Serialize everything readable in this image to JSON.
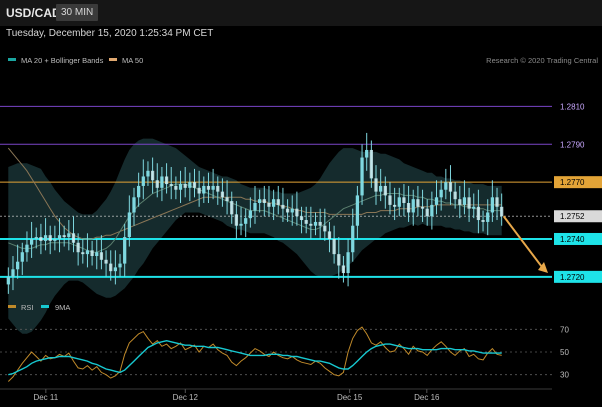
{
  "header": {
    "symbol": "USD/CAD",
    "timeframe": "30 MIN",
    "timestamp": "Tuesday, December 15, 2020 1:25:34 PM CET"
  },
  "legend_top": [
    {
      "label": "MA 20 + Bollinger Bands",
      "color": "#1aa6a0"
    },
    {
      "label": "MA 50",
      "color": "#e0a870"
    }
  ],
  "copyright": "Research © 2020 Trading Central",
  "legend_bottom": [
    {
      "label": "RSI",
      "color": "#c08a2a"
    },
    {
      "label": "9MA",
      "color": "#17c8d0"
    }
  ],
  "colors": {
    "background": "#000000",
    "candle": "#7fd8e0",
    "support": "#1ee3e8",
    "resistance_orange": "#e3a437",
    "resistance_purple": "#7a45c8",
    "arrow": "#e8a84a",
    "band_fill": "#1c3a3c"
  },
  "chart_data": [
    {
      "type": "candlestick",
      "title": "USD/CAD",
      "ylim": [
        1.2712,
        1.2825
      ],
      "y_ticks": [
        1.272,
        1.274,
        1.2752,
        1.277,
        1.279,
        1.281
      ],
      "x_tick_labels": [
        "Dec 11",
        "Dec 12",
        "Dec 15",
        "Dec 16"
      ],
      "current_price": 1.2752,
      "levels": [
        {
          "value": 1.281,
          "label": "1.2810",
          "kind": "resistance",
          "color": "#7a45c8"
        },
        {
          "value": 1.279,
          "label": "1.2790",
          "kind": "resistance",
          "color": "#7a45c8"
        },
        {
          "value": 1.277,
          "label": "1.2770",
          "kind": "pivot",
          "color": "#e3a437"
        },
        {
          "value": 1.2752,
          "label": "1.2752",
          "kind": "last-price",
          "color": "#cfcfcf"
        },
        {
          "value": 1.274,
          "label": "1.2740",
          "kind": "support",
          "color": "#1ee3e8"
        },
        {
          "value": 1.272,
          "label": "1.2720",
          "kind": "support",
          "color": "#1ee3e8"
        }
      ],
      "close": [
        1.272,
        1.2724,
        1.2728,
        1.2733,
        1.2737,
        1.274,
        1.2741,
        1.2739,
        1.2742,
        1.2739,
        1.274,
        1.2742,
        1.2741,
        1.2743,
        1.2738,
        1.2733,
        1.2732,
        1.2734,
        1.2731,
        1.2733,
        1.2729,
        1.2727,
        1.2723,
        1.2725,
        1.2727,
        1.2741,
        1.2754,
        1.2762,
        1.2768,
        1.2773,
        1.2776,
        1.2771,
        1.2767,
        1.2773,
        1.2769,
        1.2768,
        1.2766,
        1.2769,
        1.2767,
        1.277,
        1.2767,
        1.2764,
        1.2768,
        1.2766,
        1.2768,
        1.2765,
        1.2762,
        1.276,
        1.2753,
        1.2747,
        1.2748,
        1.2751,
        1.2755,
        1.2759,
        1.2761,
        1.2759,
        1.2757,
        1.2761,
        1.2758,
        1.2756,
        1.2754,
        1.2756,
        1.2752,
        1.275,
        1.2748,
        1.2747,
        1.2749,
        1.2747,
        1.2744,
        1.274,
        1.2732,
        1.2726,
        1.2722,
        1.2733,
        1.2747,
        1.2763,
        1.2783,
        1.2787,
        1.2772,
        1.2765,
        1.2768,
        1.2763,
        1.2758,
        1.2757,
        1.2762,
        1.2759,
        1.2754,
        1.2761,
        1.2757,
        1.2756,
        1.2752,
        1.2758,
        1.2762,
        1.2766,
        1.277,
        1.2765,
        1.2761,
        1.2758,
        1.2762,
        1.2756,
        1.2757,
        1.275,
        1.2749,
        1.2754,
        1.2762,
        1.2757,
        1.2752
      ],
      "ma20": [
        1.2738,
        1.2737,
        1.2736,
        1.2735,
        1.2735,
        1.2735,
        1.2736,
        1.2737,
        1.2737,
        1.2738,
        1.2738,
        1.2738,
        1.2738,
        1.2738,
        1.2737,
        1.2736,
        1.2735,
        1.2734,
        1.2733,
        1.2733,
        1.2734,
        1.2735,
        1.2737,
        1.274,
        1.2744,
        1.2748,
        1.2752,
        1.2755,
        1.2758,
        1.276,
        1.2762,
        1.2764,
        1.2765,
        1.2766,
        1.2767,
        1.2768,
        1.2769,
        1.2769,
        1.2769,
        1.2768,
        1.2767,
        1.2766,
        1.2765,
        1.2764,
        1.2763,
        1.2762,
        1.2761,
        1.276,
        1.2759,
        1.2758,
        1.2757,
        1.2756,
        1.2755,
        1.2755,
        1.2755,
        1.2755,
        1.2754,
        1.2753,
        1.2752,
        1.2751,
        1.275,
        1.2749,
        1.2748,
        1.2747,
        1.2746,
        1.2745,
        1.2745,
        1.2746,
        1.2748,
        1.275,
        1.2752,
        1.2754,
        1.2756,
        1.2757,
        1.2758,
        1.2759,
        1.276,
        1.2761,
        1.2762,
        1.2763,
        1.2763,
        1.2764,
        1.2764,
        1.2764,
        1.2764,
        1.2763,
        1.2763,
        1.2763,
        1.2762,
        1.2762,
        1.2761,
        1.2761,
        1.276,
        1.276,
        1.2759,
        1.2759,
        1.2758,
        1.2758,
        1.2757,
        1.2757,
        1.2756,
        1.2756,
        1.2756,
        1.2755,
        1.2755,
        1.2755,
        1.2755
      ],
      "ma50": [
        1.2788,
        1.2785,
        1.2782,
        1.2779,
        1.2776,
        1.2772,
        1.2768,
        1.2764,
        1.276,
        1.2756,
        1.2752,
        1.2749,
        1.2746,
        1.2744,
        1.2742,
        1.2741,
        1.274,
        1.274,
        1.274,
        1.2741,
        1.2741,
        1.2742,
        1.2742,
        1.2743,
        1.2744,
        1.2745,
        1.2746,
        1.2747,
        1.2748,
        1.2749,
        1.275,
        1.2751,
        1.2752,
        1.2753,
        1.2754,
        1.2755,
        1.2756,
        1.2757,
        1.2758,
        1.2759,
        1.276,
        1.2761,
        1.2762,
        1.2762,
        1.2762,
        1.2762,
        1.2762,
        1.2762,
        1.2762,
        1.2762,
        1.2762,
        1.2761,
        1.2761,
        1.276,
        1.276,
        1.276,
        1.2759,
        1.2759,
        1.2758,
        1.2757,
        1.2757,
        1.2756,
        1.2755,
        1.2755,
        1.2754,
        1.2754,
        1.2754,
        1.2754,
        1.2754,
        1.2753,
        1.2753,
        1.2753,
        1.2753,
        1.2753,
        1.2753,
        1.2753,
        1.2753,
        1.2754,
        1.2754,
        1.2754,
        1.2755,
        1.2755,
        1.2755,
        1.2755,
        1.2756,
        1.2756,
        1.2756,
        1.2756,
        1.2757,
        1.2757,
        1.2757,
        1.2757,
        1.2758,
        1.2758,
        1.2758,
        1.2758,
        1.2758,
        1.2758,
        1.2758,
        1.2758,
        1.2758,
        1.2758,
        1.2758,
        1.2758,
        1.2758,
        1.2758,
        1.2758
      ],
      "bb_width": [
        0.004,
        0.0042,
        0.0044,
        0.0045,
        0.0045,
        0.0044,
        0.0042,
        0.004,
        0.0036,
        0.0032,
        0.0028,
        0.0025,
        0.0022,
        0.002,
        0.0019,
        0.0018,
        0.0018,
        0.0019,
        0.002,
        0.0022,
        0.0024,
        0.0026,
        0.0028,
        0.003,
        0.0032,
        0.0034,
        0.0035,
        0.0035,
        0.0034,
        0.0033,
        0.0031,
        0.0029,
        0.0027,
        0.0025,
        0.0023,
        0.0021,
        0.0019,
        0.0017,
        0.0015,
        0.0014,
        0.0013,
        0.0012,
        0.0012,
        0.0012,
        0.0012,
        0.0012,
        0.0012,
        0.0013,
        0.0013,
        0.0013,
        0.0012,
        0.0012,
        0.0012,
        0.0012,
        0.0012,
        0.0012,
        0.0012,
        0.0012,
        0.0013,
        0.0013,
        0.0014,
        0.0015,
        0.0016,
        0.0018,
        0.002,
        0.0022,
        0.0024,
        0.0026,
        0.0028,
        0.003,
        0.0031,
        0.0032,
        0.0032,
        0.0031,
        0.003,
        0.0028,
        0.0026,
        0.0025,
        0.0024,
        0.0023,
        0.0022,
        0.0021,
        0.002,
        0.0019,
        0.0018,
        0.0017,
        0.0016,
        0.0015,
        0.0015,
        0.0014,
        0.0014,
        0.0014,
        0.0013,
        0.0013,
        0.0013,
        0.0013,
        0.0013,
        0.0013,
        0.0013,
        0.0013,
        0.0013,
        0.0013,
        0.0013,
        0.0013,
        0.0013,
        0.0013,
        0.0013
      ],
      "projection": {
        "from": 1.2752,
        "to": 1.2722
      }
    },
    {
      "type": "line",
      "title": "RSI",
      "ylim": [
        20,
        80
      ],
      "y_ticks": [
        30,
        50,
        70
      ],
      "series": [
        {
          "name": "RSI",
          "color": "#c08a2a",
          "values": [
            24,
            28,
            34,
            40,
            45,
            50,
            46,
            42,
            47,
            44,
            45,
            48,
            46,
            49,
            42,
            36,
            35,
            38,
            34,
            37,
            32,
            30,
            27,
            29,
            33,
            48,
            58,
            62,
            66,
            68,
            62,
            57,
            60,
            55,
            57,
            53,
            55,
            58,
            52,
            54,
            56,
            50,
            55,
            54,
            57,
            52,
            49,
            47,
            41,
            38,
            42,
            45,
            49,
            53,
            51,
            48,
            46,
            50,
            47,
            45,
            44,
            46,
            43,
            41,
            40,
            39,
            42,
            40,
            36,
            33,
            30,
            29,
            32,
            50,
            62,
            69,
            72,
            66,
            58,
            56,
            59,
            54,
            50,
            51,
            57,
            53,
            48,
            55,
            51,
            50,
            47,
            52,
            56,
            59,
            55,
            50,
            47,
            51,
            53,
            46,
            48,
            44,
            43,
            49,
            53,
            48,
            47
          ]
        },
        {
          "name": "9MA",
          "color": "#17c8d0",
          "values": [
            30,
            31,
            33,
            35,
            37,
            40,
            42,
            43,
            44,
            45,
            45,
            46,
            46,
            46,
            45,
            44,
            43,
            42,
            40,
            39,
            37,
            35,
            34,
            33,
            32,
            34,
            38,
            42,
            46,
            50,
            54,
            56,
            58,
            59,
            60,
            59,
            58,
            57,
            56,
            56,
            55,
            55,
            55,
            54,
            54,
            54,
            53,
            52,
            51,
            50,
            49,
            48,
            47,
            47,
            47,
            47,
            48,
            48,
            48,
            47,
            47,
            46,
            46,
            45,
            44,
            43,
            42,
            42,
            41,
            40,
            38,
            36,
            35,
            35,
            38,
            42,
            46,
            50,
            53,
            55,
            56,
            57,
            57,
            56,
            55,
            54,
            53,
            53,
            53,
            52,
            52,
            52,
            52,
            53,
            53,
            53,
            52,
            52,
            52,
            51,
            51,
            50,
            49,
            49,
            49,
            49,
            49
          ]
        }
      ]
    }
  ]
}
